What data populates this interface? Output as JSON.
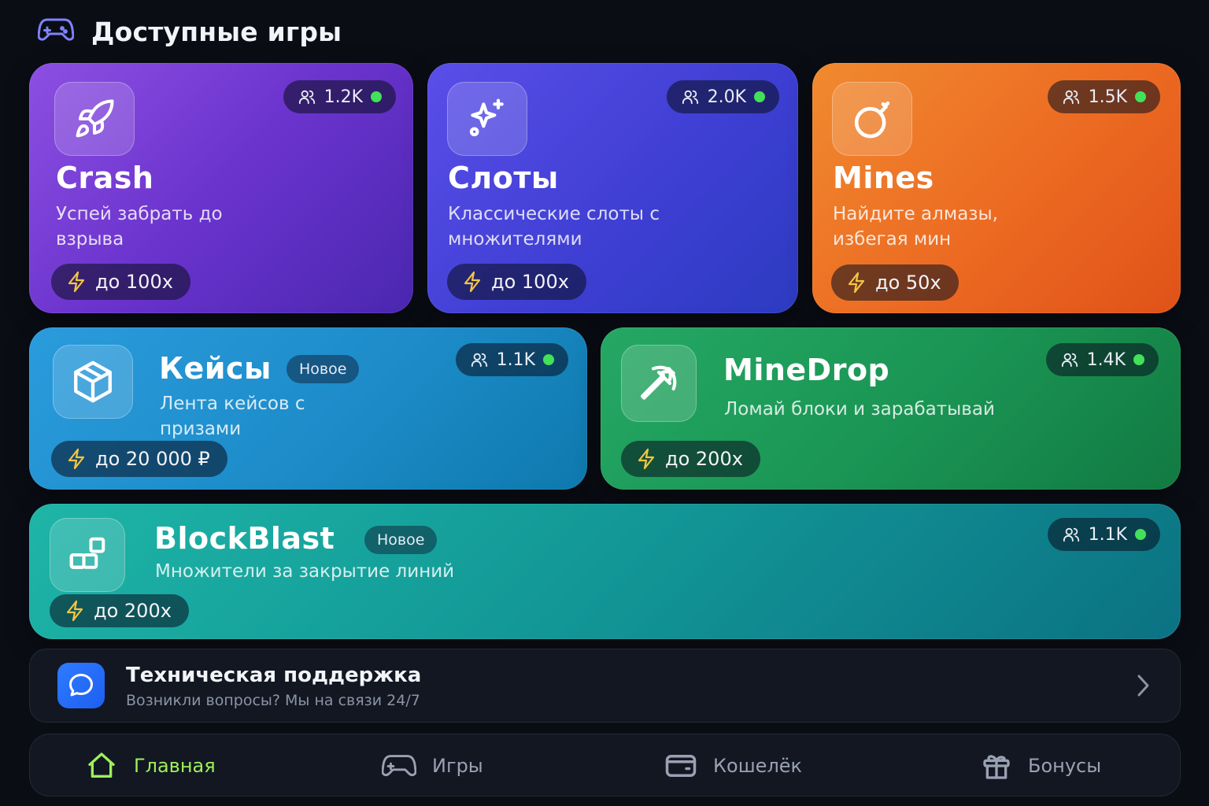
{
  "header": {
    "title": "Доступные игры",
    "icon": "gamepad-icon"
  },
  "games": {
    "crash": {
      "name": "Crash",
      "desc": "Успей забрать до взрыва",
      "online": "1.2K",
      "mult": "до 100x",
      "icon": "rocket-icon",
      "color": "#7a3ed8"
    },
    "slots": {
      "name": "Слоты",
      "desc": "Классические слоты с множителями",
      "online": "2.0K",
      "mult": "до 100x",
      "icon": "sparkles-icon",
      "color": "#4444d8"
    },
    "mines": {
      "name": "Mines",
      "desc": "Найдите алмазы, избегая мин",
      "online": "1.5K",
      "mult": "до 50x",
      "icon": "bomb-icon",
      "color": "#ec6a22"
    },
    "cases": {
      "name": "Кейсы",
      "badge": "Новое",
      "desc": "Лента кейсов с призами",
      "online": "1.1K",
      "mult": "до 20 000 ₽",
      "icon": "box-icon",
      "color": "#1d8cc9"
    },
    "minedrop": {
      "name": "MineDrop",
      "desc": "Ломай блоки и зарабатывай",
      "online": "1.4K",
      "mult": "до 200x",
      "icon": "pickaxe-icon",
      "color": "#1a9453"
    },
    "blockblast": {
      "name": "BlockBlast",
      "badge": "Новое",
      "desc": "Множители за закрытие линий",
      "online": "1.1K",
      "mult": "до 200x",
      "icon": "blocks-icon",
      "color": "#139a98"
    }
  },
  "support": {
    "title": "Техническая поддержка",
    "subtitle": "Возникли вопросы? Мы на связи 24/7",
    "icon": "chat-icon"
  },
  "nav": {
    "home": {
      "label": "Главная",
      "active": true,
      "icon": "home-icon"
    },
    "games": {
      "label": "Игры",
      "icon": "gamepad-icon"
    },
    "wallet": {
      "label": "Кошелёк",
      "icon": "wallet-icon"
    },
    "bonuses": {
      "label": "Бонусы",
      "icon": "gift-icon"
    }
  },
  "colors": {
    "accent": "#9ef05a",
    "online_dot": "#43e05a",
    "bolt": "#f5c542",
    "background": "#0a0d14"
  }
}
